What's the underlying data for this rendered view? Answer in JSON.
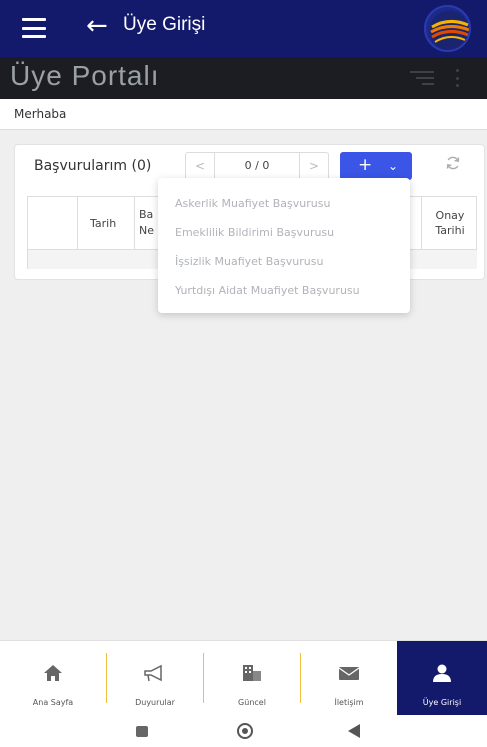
{
  "appbar": {
    "title": "Üye Girişi"
  },
  "portal": {
    "title": "Üye Portalı"
  },
  "greeting": "Merhaba",
  "applications": {
    "title": "Başvurularım",
    "count": "(0)",
    "prev": "<",
    "pager": "0 / 0",
    "next": ">",
    "add": "+",
    "add_chevron": "⌄"
  },
  "table": {
    "headers": [
      {
        "line1": "Tarih",
        "line2": ""
      },
      {
        "line1": "Ba",
        "line2": "Ne"
      },
      {
        "line1": "Onay",
        "line2": "Tarihi"
      }
    ]
  },
  "dropdown": {
    "items": [
      "Askerlik Muafiyet Başvurusu",
      "Emeklilik Bildirimi Başvurusu",
      "İşsizlik Muafiyet Başvurusu",
      "Yurtdışı Aidat Muafiyet Başvurusu"
    ]
  },
  "bottom_nav": {
    "items": [
      {
        "label": "Ana Sayfa",
        "icon": "home-icon"
      },
      {
        "label": "Duyurular",
        "icon": "megaphone-icon"
      },
      {
        "label": "Güncel",
        "icon": "building-icon"
      },
      {
        "label": "İletişim",
        "icon": "mail-icon"
      },
      {
        "label": "Üye Girişi",
        "icon": "user-icon"
      }
    ],
    "active_index": 4
  },
  "colors": {
    "primary": "#131a6b",
    "accent": "#3b55e6",
    "separator": "#f0c040"
  }
}
